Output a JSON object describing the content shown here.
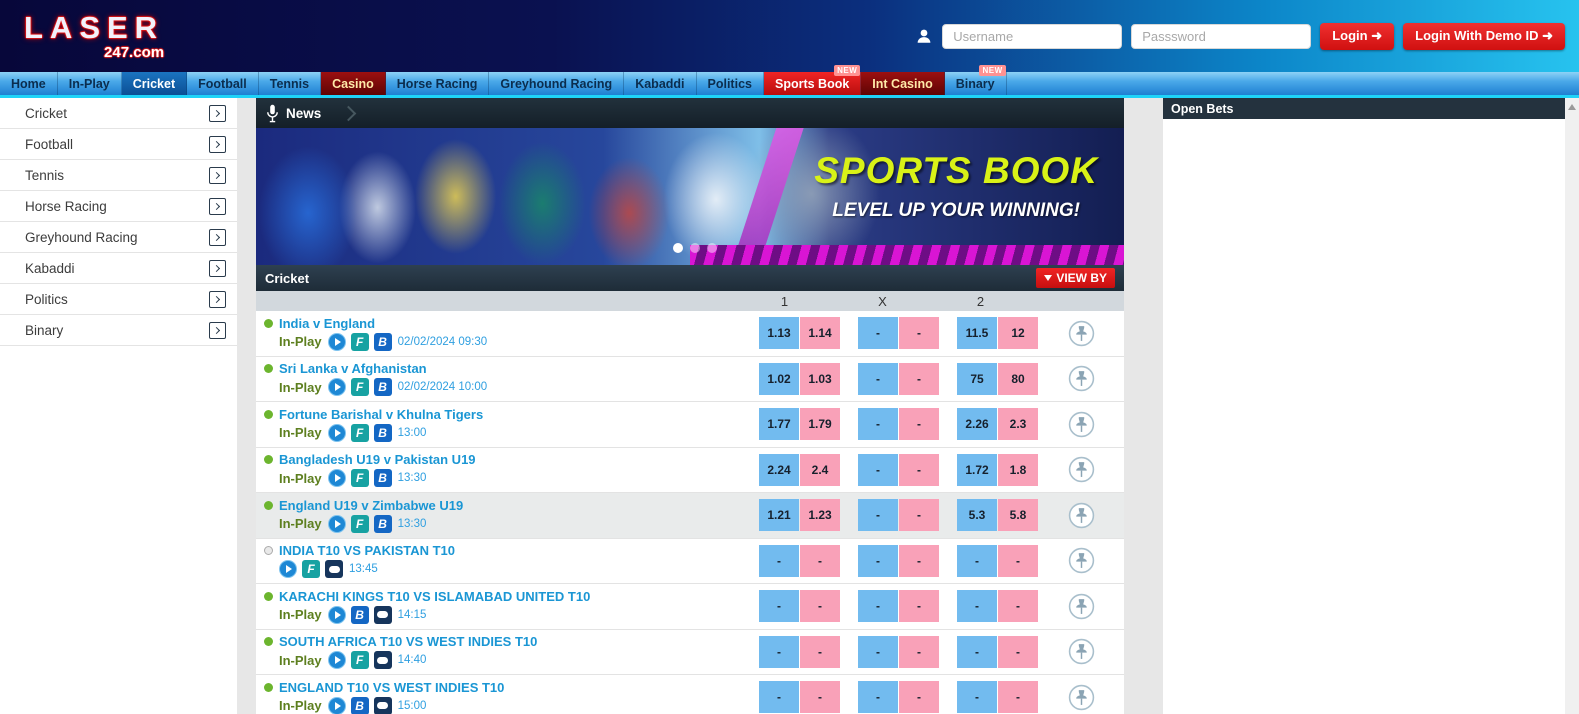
{
  "header": {
    "logo_text": "LASER",
    "logo_domain": "247.com",
    "username_placeholder": "Username",
    "password_placeholder": "Passsword",
    "login_label": "Login ➜",
    "demo_login_label": "Login With Demo ID ➜"
  },
  "nav": {
    "items": [
      {
        "label": "Home",
        "style": "default"
      },
      {
        "label": "In-Play",
        "style": "default"
      },
      {
        "label": "Cricket",
        "style": "active"
      },
      {
        "label": "Football",
        "style": "default"
      },
      {
        "label": "Tennis",
        "style": "default"
      },
      {
        "label": "Casino",
        "style": "maroon"
      },
      {
        "label": "Horse Racing",
        "style": "default"
      },
      {
        "label": "Greyhound Racing",
        "style": "default"
      },
      {
        "label": "Kabaddi",
        "style": "default"
      },
      {
        "label": "Politics",
        "style": "default"
      },
      {
        "label": "Sports Book",
        "style": "red",
        "badge": "NEW"
      },
      {
        "label": "Int Casino",
        "style": "maroon"
      },
      {
        "label": "Binary",
        "style": "default",
        "badge": "NEW"
      }
    ]
  },
  "sidebar": {
    "items": [
      {
        "label": "Cricket"
      },
      {
        "label": "Football"
      },
      {
        "label": "Tennis"
      },
      {
        "label": "Horse Racing"
      },
      {
        "label": "Greyhound Racing"
      },
      {
        "label": "Kabaddi"
      },
      {
        "label": "Politics"
      },
      {
        "label": "Binary"
      }
    ]
  },
  "news": {
    "label": "News"
  },
  "banner": {
    "title": "SPORTS BOOK",
    "subtitle": "LEVEL UP YOUR WINNING!",
    "dots_total": 3,
    "active_dot": 1
  },
  "section": {
    "title": "Cricket",
    "view_by_label": "VIEW BY",
    "in_play_label": "In-Play",
    "columns": [
      "1",
      "X",
      "2"
    ],
    "matches": [
      {
        "name": "India v England",
        "live": true,
        "in_play": true,
        "icons": [
          "play",
          "f",
          "b"
        ],
        "time": "02/02/2024 09:30",
        "odds": [
          "1.13",
          "1.14",
          "-",
          "-",
          "11.5",
          "12"
        ],
        "highlight": false
      },
      {
        "name": "Sri Lanka v Afghanistan",
        "live": true,
        "in_play": true,
        "icons": [
          "play",
          "f",
          "b"
        ],
        "time": "02/02/2024 10:00",
        "odds": [
          "1.02",
          "1.03",
          "-",
          "-",
          "75",
          "80"
        ],
        "highlight": false
      },
      {
        "name": "Fortune Barishal v Khulna Tigers",
        "live": true,
        "in_play": true,
        "icons": [
          "play",
          "f",
          "b"
        ],
        "time": "13:00",
        "odds": [
          "1.77",
          "1.79",
          "-",
          "-",
          "2.26",
          "2.3"
        ],
        "highlight": false
      },
      {
        "name": "Bangladesh U19 v Pakistan U19",
        "live": true,
        "in_play": true,
        "icons": [
          "play",
          "f",
          "b"
        ],
        "time": "13:30",
        "odds": [
          "2.24",
          "2.4",
          "-",
          "-",
          "1.72",
          "1.8"
        ],
        "highlight": false
      },
      {
        "name": "England U19 v Zimbabwe U19",
        "live": true,
        "in_play": true,
        "icons": [
          "play",
          "f",
          "b"
        ],
        "time": "13:30",
        "odds": [
          "1.21",
          "1.23",
          "-",
          "-",
          "5.3",
          "5.8"
        ],
        "highlight": true
      },
      {
        "name": "INDIA T10 VS PAKISTAN T10",
        "live": false,
        "in_play": false,
        "icons": [
          "play",
          "f",
          "gamepad"
        ],
        "time": "13:45",
        "odds": [
          "-",
          "-",
          "-",
          "-",
          "-",
          "-"
        ],
        "highlight": false
      },
      {
        "name": "KARACHI KINGS T10 VS ISLAMABAD UNITED T10",
        "live": true,
        "in_play": true,
        "icons": [
          "play",
          "b",
          "gamepad"
        ],
        "time": "14:15",
        "odds": [
          "-",
          "-",
          "-",
          "-",
          "-",
          "-"
        ],
        "highlight": false
      },
      {
        "name": "SOUTH AFRICA T10 VS WEST INDIES T10",
        "live": true,
        "in_play": true,
        "icons": [
          "play",
          "f",
          "gamepad"
        ],
        "time": "14:40",
        "odds": [
          "-",
          "-",
          "-",
          "-",
          "-",
          "-"
        ],
        "highlight": false
      },
      {
        "name": "ENGLAND T10 VS WEST INDIES T10",
        "live": true,
        "in_play": true,
        "icons": [
          "play",
          "b",
          "gamepad"
        ],
        "time": "15:00",
        "odds": [
          "-",
          "-",
          "-",
          "-",
          "-",
          "-"
        ],
        "highlight": false
      }
    ]
  },
  "open_bets": {
    "title": "Open Bets"
  },
  "colors": {
    "back_cell": "#72bbef",
    "lay_cell": "#f9a1b8",
    "live_green": "#6cb52e",
    "in_play_green": "#5d7f1f",
    "link_blue": "#1a96d4",
    "accent_red": "#e01b22",
    "nav_blue": "#2f9be6",
    "header_dark": "#24323e",
    "cyan_line": "#1fd3f8",
    "banner_title_yellow": "#d9f217"
  }
}
